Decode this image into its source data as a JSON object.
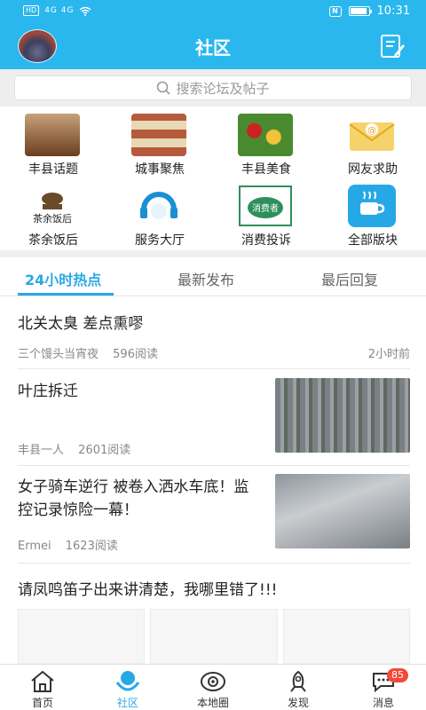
{
  "status_bar": {
    "left": "HD",
    "signal": "4G 4G",
    "time": "10:31",
    "battery_level": 0.9
  },
  "header": {
    "title": "社区"
  },
  "search": {
    "placeholder": "搜索论坛及帖子"
  },
  "categories": [
    {
      "label": "丰县话题",
      "icon": "coffee-image-icon"
    },
    {
      "label": "城事聚焦",
      "icon": "news-image-icon",
      "badge": "城事聚焦"
    },
    {
      "label": "丰县美食",
      "icon": "food-image-icon"
    },
    {
      "label": "网友求助",
      "icon": "mail-icon"
    },
    {
      "label": "茶余饭后",
      "icon": "teapot-icon",
      "badge": "茶余饭后"
    },
    {
      "label": "服务大厅",
      "icon": "headset-icon"
    },
    {
      "label": "消费投诉",
      "icon": "consumer-icon",
      "badge": "消费者"
    },
    {
      "label": "全部版块",
      "icon": "cup-icon"
    }
  ],
  "tabs": [
    {
      "label": "24小时热点",
      "active": true
    },
    {
      "label": "最新发布",
      "active": false
    },
    {
      "label": "最后回复",
      "active": false
    }
  ],
  "posts": [
    {
      "title": "北关太臭 差点熏嘐",
      "author": "三个馒头当宵夜",
      "reads": "596阅读",
      "time": "2小时前"
    },
    {
      "title": "叶庄拆迁",
      "author": "丰县一人",
      "reads": "2601阅读"
    },
    {
      "title": "女子骑车逆行 被卷入洒水车底！监控记录惊险一幕！",
      "author": "Ermei",
      "reads": "1623阅读"
    },
    {
      "title": "请凤鸣笛子出来讲清楚，我哪里错了!!!"
    }
  ],
  "bottom_nav": [
    {
      "label": "首页",
      "active": false
    },
    {
      "label": "社区",
      "active": true
    },
    {
      "label": "本地圈",
      "active": false
    },
    {
      "label": "发现",
      "active": false
    },
    {
      "label": "消息",
      "active": false,
      "badge": "85"
    }
  ],
  "colors": {
    "primary": "#29b7ee",
    "accent": "#29a8e6",
    "badge": "#f24a3a"
  }
}
